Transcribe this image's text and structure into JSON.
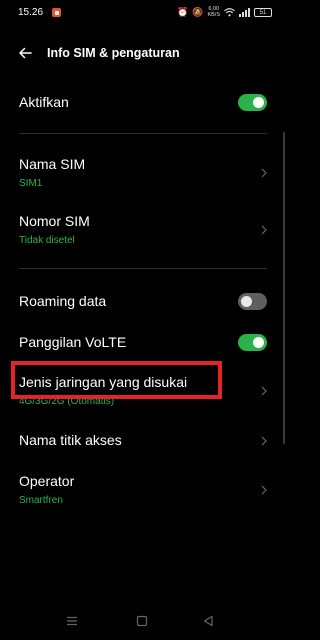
{
  "status_bar": {
    "time": "15.26",
    "icons": [
      "notification-icon",
      "alarm-icon",
      "mute-icon",
      "data-speed-icon",
      "wifi-icon",
      "signal-icon",
      "battery-icon"
    ],
    "speed_value": "6,00",
    "speed_unit": "KB/S",
    "battery_level": "51"
  },
  "header": {
    "title": "Info SIM & pengaturan",
    "back_icon": "arrow-left-icon"
  },
  "settings": {
    "activate": {
      "label": "Aktifkan",
      "enabled": true
    },
    "sim_name": {
      "label": "Nama SIM",
      "value": "SIM1"
    },
    "sim_number": {
      "label": "Nomor SIM",
      "value": "Tidak disetel"
    },
    "roaming": {
      "label": "Roaming data",
      "enabled": false
    },
    "volte": {
      "label": "Panggilan VoLTE",
      "enabled": true
    },
    "network_type": {
      "label": "Jenis jaringan yang disukai",
      "value": "4G/3G/2G (Otomatis)"
    },
    "apn": {
      "label": "Nama titik akses"
    },
    "operator": {
      "label": "Operator",
      "value": "Smartfren"
    }
  },
  "colors": {
    "background": "#000000",
    "accent": "#2bb24c",
    "highlight": "#e2232a",
    "divider": "#2d2d2d"
  },
  "nav_bar": {
    "icons": [
      "menu-icon",
      "home-icon",
      "back-icon"
    ]
  }
}
